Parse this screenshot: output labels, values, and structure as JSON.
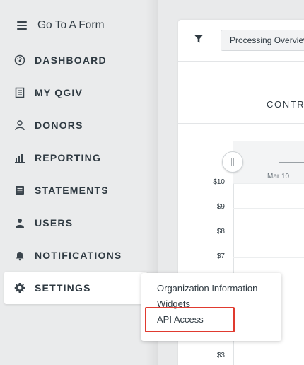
{
  "sidebar": {
    "goto_label": "Go To A Form",
    "items": [
      {
        "label": "DASHBOARD",
        "icon": "dashboard-icon"
      },
      {
        "label": "MY QGIV",
        "icon": "document-icon"
      },
      {
        "label": "DONORS",
        "icon": "donors-icon"
      },
      {
        "label": "REPORTING",
        "icon": "bar-chart-icon"
      },
      {
        "label": "STATEMENTS",
        "icon": "statements-icon"
      },
      {
        "label": "USERS",
        "icon": "user-icon"
      },
      {
        "label": "NOTIFICATIONS",
        "icon": "bell-icon"
      },
      {
        "label": "SETTINGS",
        "icon": "gear-icon"
      }
    ]
  },
  "toolbar": {
    "report_select_value": "Processing Overview"
  },
  "main": {
    "section_title": "CONTRI",
    "range_date": "Mar 10",
    "y_ticks": [
      "$10",
      "$9",
      "$8",
      "$7",
      "$3"
    ]
  },
  "settings_menu": {
    "items": [
      "Organization Information",
      "Widgets",
      "API Access"
    ]
  },
  "colors": {
    "highlight": "#e03a2f",
    "text": "#2f3a42",
    "sidebar_bg": "#eaebec"
  }
}
